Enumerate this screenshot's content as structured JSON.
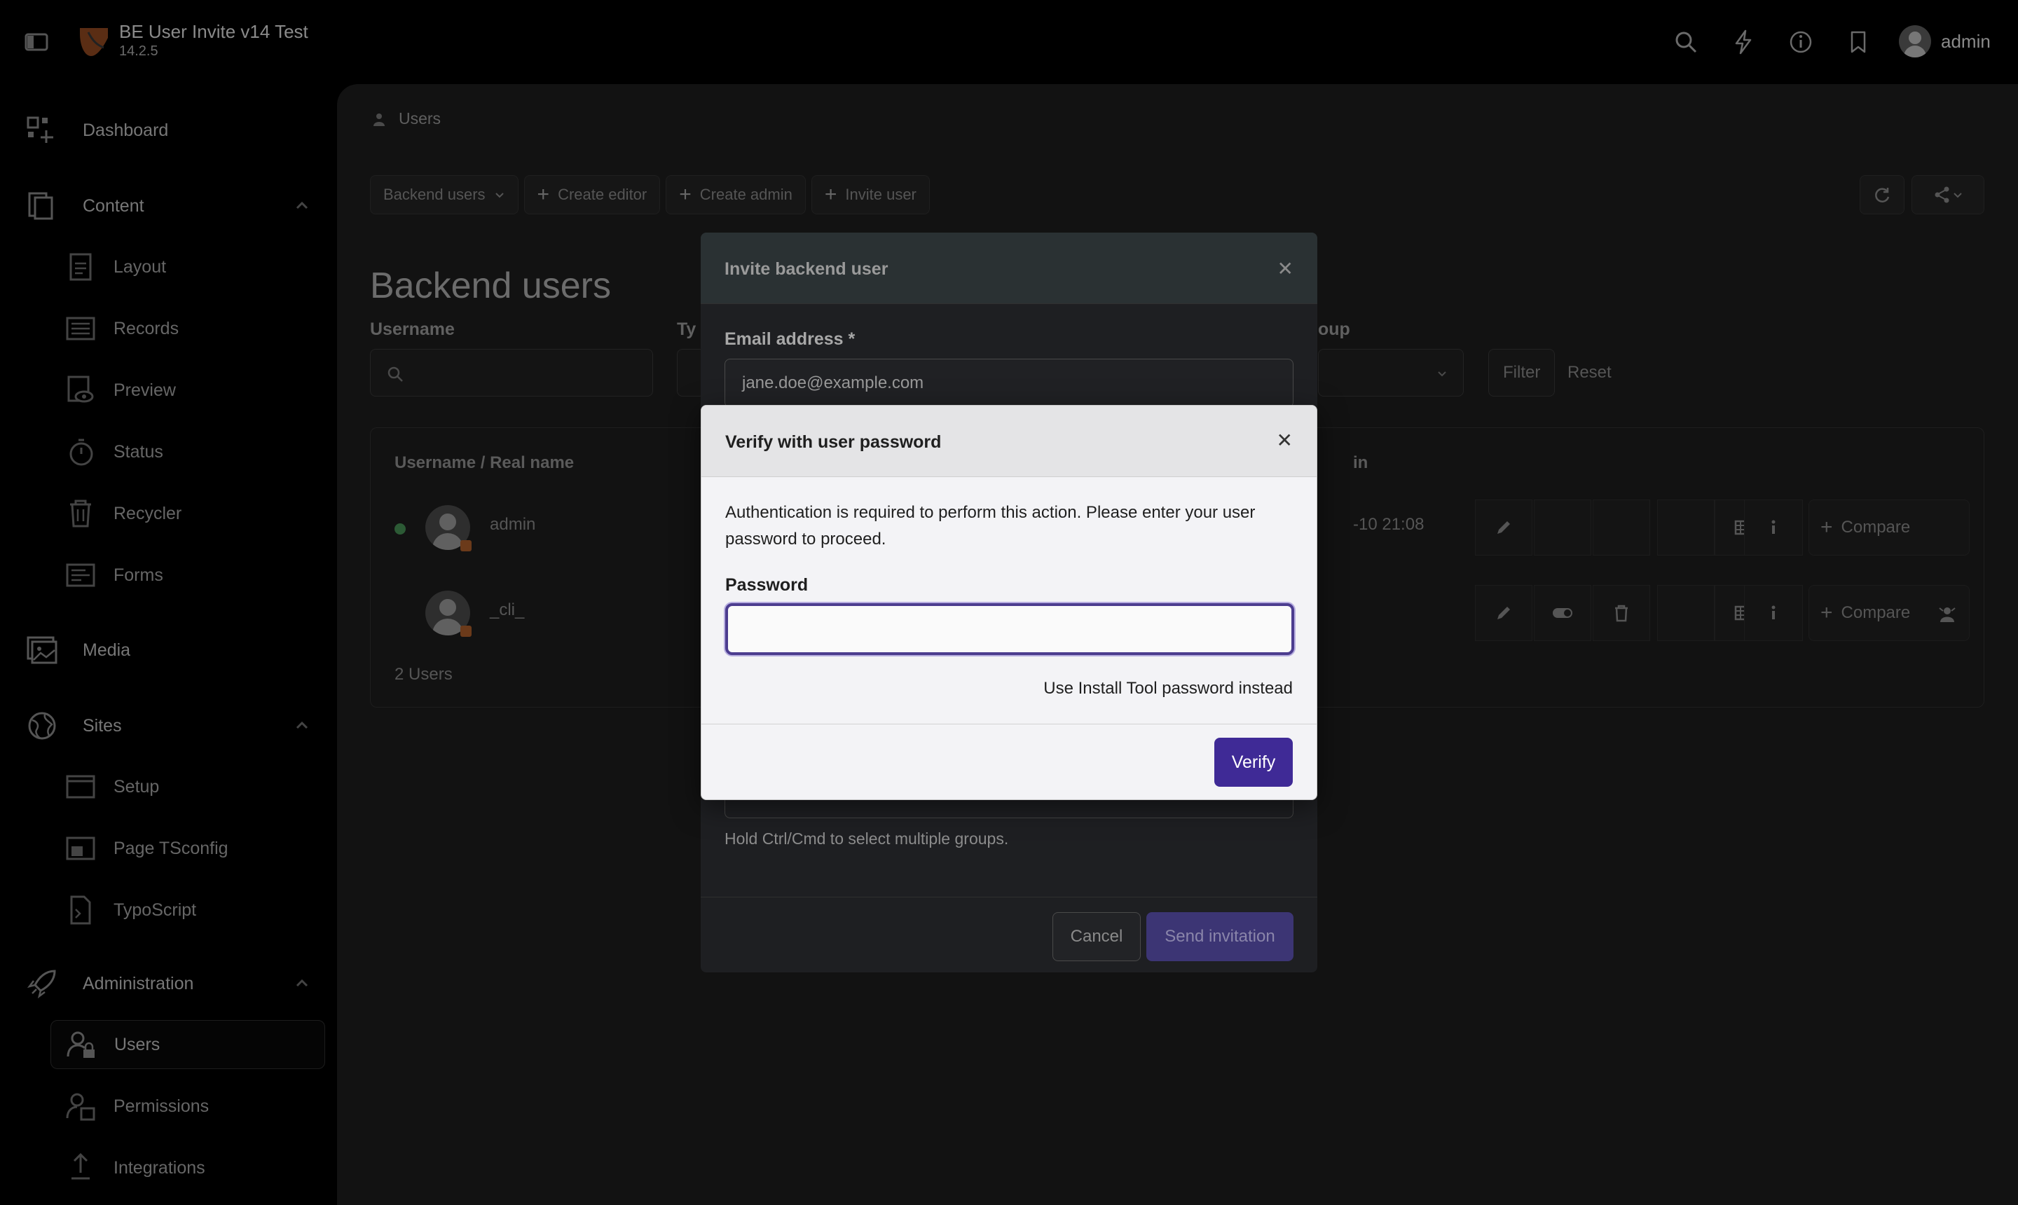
{
  "topbar": {
    "site_title": "BE User Invite v14 Test",
    "version": "14.2.5",
    "username": "admin",
    "icons": [
      "sidebar-toggle-icon",
      "search-icon",
      "lightning-icon",
      "info-icon",
      "bookmark-icon"
    ]
  },
  "sidebar": {
    "dashboard": "Dashboard",
    "content": {
      "label": "Content",
      "items": [
        "Layout",
        "Records",
        "Preview",
        "Status",
        "Recycler",
        "Forms"
      ]
    },
    "media": "Media",
    "sites": {
      "label": "Sites",
      "items": [
        "Setup",
        "Page TSconfig",
        "TypoScript"
      ]
    },
    "administration": {
      "label": "Administration",
      "items": [
        "Users",
        "Permissions",
        "Integrations"
      ]
    }
  },
  "main": {
    "breadcrumb": "Users",
    "toolbar": {
      "dropdown": "Backend users",
      "create_editor": "Create editor",
      "create_admin": "Create admin",
      "invite_user": "Invite user"
    },
    "page_title": "Backend users",
    "filters": {
      "username_label": "Username",
      "type_label": "Ty",
      "group_label": "oup",
      "filter_button": "Filter",
      "reset_link": "Reset"
    },
    "table": {
      "col_user": "Username / Real name",
      "col_login": "in",
      "rows": [
        {
          "username": "admin",
          "last_login": "-10 21:08"
        },
        {
          "username": "_cli_",
          "last_login": ""
        }
      ],
      "compare_label": "Compare",
      "count": "2 Users"
    }
  },
  "invite_modal": {
    "title": "Invite backend user",
    "email_label": "Email address *",
    "email_value": "jane.doe@example.com",
    "groups_hint": "Hold Ctrl/Cmd to select multiple groups.",
    "cancel": "Cancel",
    "send": "Send invitation"
  },
  "verify_modal": {
    "title": "Verify with user password",
    "message": "Authentication is required to perform this action. Please enter your user password to proceed.",
    "password_label": "Password",
    "password_value": "",
    "install_tool_link": "Use Install Tool password instead",
    "verify_button": "Verify"
  },
  "colors": {
    "accent": "#3f2a96",
    "focus_ring": "#4c3d8f",
    "background": "#000000"
  }
}
